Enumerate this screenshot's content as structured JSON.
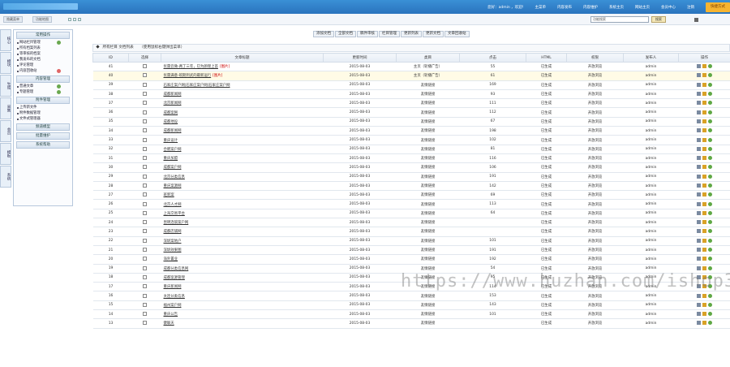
{
  "header": {
    "welcome": "您好：admin ，欢迎!",
    "nav": [
      "主菜单",
      "内容发布",
      "内容维护",
      "系统主页",
      "网站主页",
      "会员中心",
      "注销"
    ],
    "quick_button": "快捷方式"
  },
  "bar2": {
    "left_buttons": [
      "隐藏菜单",
      "功能地图"
    ],
    "search_placeholder": "功能搜索",
    "search_button": "搜索"
  },
  "vtabs": [
    "核心",
    "模块",
    "生成",
    "采集",
    "会员",
    "模板",
    "系统"
  ],
  "sidebar": {
    "groups": [
      {
        "title": "常用操作",
        "items": [
          "网站栏目管理",
          "所有档案列表",
          "等审核的档案",
          "我发布的文档",
          "评论管理",
          "内容回收站"
        ]
      },
      {
        "title": "内容管理",
        "items": [
          "普通文章",
          "专题管理"
        ]
      },
      {
        "title": "附件管理",
        "items": [
          "上传新文件",
          "附件数据管理",
          "文件式管理器"
        ]
      },
      {
        "title": "频道模型",
        "items": []
      },
      {
        "title": "批量维护",
        "items": []
      },
      {
        "title": "系统帮助",
        "items": []
      }
    ]
  },
  "toolbar": [
    "添加文档",
    "全部文档",
    "稿件审核",
    "栏目管理",
    "更新列表",
    "更新文档",
    "文章回收站"
  ],
  "list": {
    "heading": "所有栏目 文档列表",
    "hint": "（使用鼠标右键弹出菜单）",
    "columns": [
      "ID",
      "选择",
      "文章标题",
      "更新时间",
      "类目",
      "点击",
      "HTML",
      "权限",
      "发布人",
      "操作"
    ],
    "rows": [
      {
        "id": "41",
        "title": "优雷云微-两丁三年，巳为颜理上首",
        "img": "[图片]",
        "date": "2015-08-03",
        "cat": "主页（轮播广告）",
        "clicks": "55",
        "html": "已生成",
        "perm": "开放浏览",
        "author": "admin",
        "hl": false
      },
      {
        "id": "40",
        "title": "优雷满意-皖期到武的最新运行",
        "img": "[图片]",
        "date": "2015-08-03",
        "cat": "主页（轮播广告）",
        "clicks": "61",
        "html": "已生成",
        "perm": "开放浏览",
        "author": "admin",
        "hl": true
      },
      {
        "id": "39",
        "title": "石家庄案户网|石家庄案户网|石家庄案户网",
        "img": "",
        "date": "2015-08-03",
        "cat": "友情链接",
        "clicks": "169",
        "html": "已生成",
        "perm": "开放浏览",
        "author": "admin",
        "hl": false
      },
      {
        "id": "38",
        "title": "成都新闻网",
        "img": "",
        "date": "2015-08-03",
        "cat": "友情链接",
        "clicks": "93",
        "html": "已生成",
        "perm": "开放浏览",
        "author": "admin",
        "hl": false
      },
      {
        "id": "37",
        "title": "北京新闻网",
        "img": "",
        "date": "2015-08-03",
        "cat": "友情链接",
        "clicks": "111",
        "html": "已生成",
        "perm": "开放浏览",
        "author": "admin",
        "hl": false
      },
      {
        "id": "36",
        "title": "成都案网",
        "img": "",
        "date": "2015-08-03",
        "cat": "友情链接",
        "clicks": "112",
        "html": "已生成",
        "perm": "开放浏览",
        "author": "admin",
        "hl": false
      },
      {
        "id": "35",
        "title": "成都地设",
        "img": "",
        "date": "2015-08-03",
        "cat": "友情链接",
        "clicks": "67",
        "html": "已生成",
        "perm": "开放浏览",
        "author": "admin",
        "hl": false
      },
      {
        "id": "34",
        "title": "成都新闻网",
        "img": "",
        "date": "2015-08-03",
        "cat": "友情链接",
        "clicks": "198",
        "html": "已生成",
        "perm": "开放浏览",
        "author": "admin",
        "hl": false
      },
      {
        "id": "33",
        "title": "重庆设计",
        "img": "",
        "date": "2015-08-03",
        "cat": "友情链接",
        "clicks": "102",
        "html": "已生成",
        "perm": "开放浏览",
        "author": "admin",
        "hl": false
      },
      {
        "id": "32",
        "title": "合肥案户网",
        "img": "",
        "date": "2015-08-03",
        "cat": "友情链接",
        "clicks": "81",
        "html": "已生成",
        "perm": "开放浏览",
        "author": "admin",
        "hl": false
      },
      {
        "id": "31",
        "title": "重庆加盟",
        "img": "",
        "date": "2015-08-03",
        "cat": "友情链接",
        "clicks": "116",
        "html": "已生成",
        "perm": "开放浏览",
        "author": "admin",
        "hl": false
      },
      {
        "id": "30",
        "title": "成都案户网",
        "img": "",
        "date": "2015-08-03",
        "cat": "友情链接",
        "clicks": "106",
        "html": "已生成",
        "perm": "开放浏览",
        "author": "admin",
        "hl": false
      },
      {
        "id": "29",
        "title": "北京分类信息",
        "img": "",
        "date": "2015-08-03",
        "cat": "友情链接",
        "clicks": "191",
        "html": "已生成",
        "perm": "开放浏览",
        "author": "admin",
        "hl": false
      },
      {
        "id": "28",
        "title": "重庆案源网",
        "img": "",
        "date": "2015-08-03",
        "cat": "友情链接",
        "clicks": "142",
        "html": "已生成",
        "perm": "开放浏览",
        "author": "admin",
        "hl": false
      },
      {
        "id": "27",
        "title": "班新案",
        "img": "",
        "date": "2015-08-03",
        "cat": "友情链接",
        "clicks": "69",
        "html": "已生成",
        "perm": "开放浏览",
        "author": "admin",
        "hl": false
      },
      {
        "id": "26",
        "title": "北京人才网",
        "img": "",
        "date": "2015-08-03",
        "cat": "友情链接",
        "clicks": "113",
        "html": "已生成",
        "perm": "开放浏览",
        "author": "admin",
        "hl": false
      },
      {
        "id": "25",
        "title": "上海交易平台",
        "img": "",
        "date": "2015-08-03",
        "cat": "友情链接",
        "clicks": "64",
        "html": "已生成",
        "perm": "开放浏览",
        "author": "admin",
        "hl": false
      },
      {
        "id": "24",
        "title": "昆明连锁案户网",
        "img": "",
        "date": "2015-08-03",
        "cat": "友情链接",
        "clicks": "",
        "html": "已生成",
        "perm": "开放浏览",
        "author": "admin",
        "hl": false
      },
      {
        "id": "23",
        "title": "成都店铺网",
        "img": "",
        "date": "2015-08-03",
        "cat": "友情链接",
        "clicks": "",
        "html": "已生成",
        "perm": "开放浏览",
        "author": "admin",
        "hl": false
      },
      {
        "id": "22",
        "title": "深圳案地户",
        "img": "",
        "date": "2015-08-03",
        "cat": "友情链接",
        "clicks": "101",
        "html": "已生成",
        "perm": "开放浏览",
        "author": "admin",
        "hl": false
      },
      {
        "id": "21",
        "title": "深圳效果图",
        "img": "",
        "date": "2015-08-03",
        "cat": "友情链接",
        "clicks": "191",
        "html": "已生成",
        "perm": "开放浏览",
        "author": "admin",
        "hl": false
      },
      {
        "id": "20",
        "title": "海外置业",
        "img": "",
        "date": "2015-08-03",
        "cat": "友情链接",
        "clicks": "192",
        "html": "已生成",
        "perm": "开放浏览",
        "author": "admin",
        "hl": false
      },
      {
        "id": "19",
        "title": "成都分类信息网",
        "img": "",
        "date": "2015-08-03",
        "cat": "友情链接",
        "clicks": "54",
        "html": "已生成",
        "perm": "开放浏览",
        "author": "admin",
        "hl": false
      },
      {
        "id": "18",
        "title": "成都案源管理",
        "img": "",
        "date": "2015-08-03",
        "cat": "友情链接",
        "clicks": "95",
        "html": "已生成",
        "perm": "开放浏览",
        "author": "admin",
        "hl": false
      },
      {
        "id": "17",
        "title": "重庆新闻网",
        "img": "",
        "date": "2015-08-03",
        "cat": "友情链接",
        "clicks": "114",
        "html": "已生成",
        "perm": "开放浏览",
        "author": "admin",
        "hl": false
      },
      {
        "id": "16",
        "title": "太连分类信息",
        "img": "",
        "date": "2015-08-03",
        "cat": "友情链接",
        "clicks": "153",
        "html": "已生成",
        "perm": "开放浏览",
        "author": "admin",
        "hl": false
      },
      {
        "id": "15",
        "title": "福州案户网",
        "img": "",
        "date": "2015-08-03",
        "cat": "友情链接",
        "clicks": "143",
        "html": "已生成",
        "perm": "开放浏览",
        "author": "admin",
        "hl": false
      },
      {
        "id": "14",
        "title": "重庆公告",
        "img": "",
        "date": "2015-08-03",
        "cat": "友情链接",
        "clicks": "101",
        "html": "已生成",
        "perm": "开放浏览",
        "author": "admin",
        "hl": false
      },
      {
        "id": "13",
        "title": "健联天",
        "img": "",
        "date": "2015-08-03",
        "cat": "友情链接",
        "clicks": "",
        "html": "已生成",
        "perm": "开放浏览",
        "author": "admin",
        "hl": false
      }
    ]
  },
  "watermark": "https://www.huzhan.com/ishop30273"
}
